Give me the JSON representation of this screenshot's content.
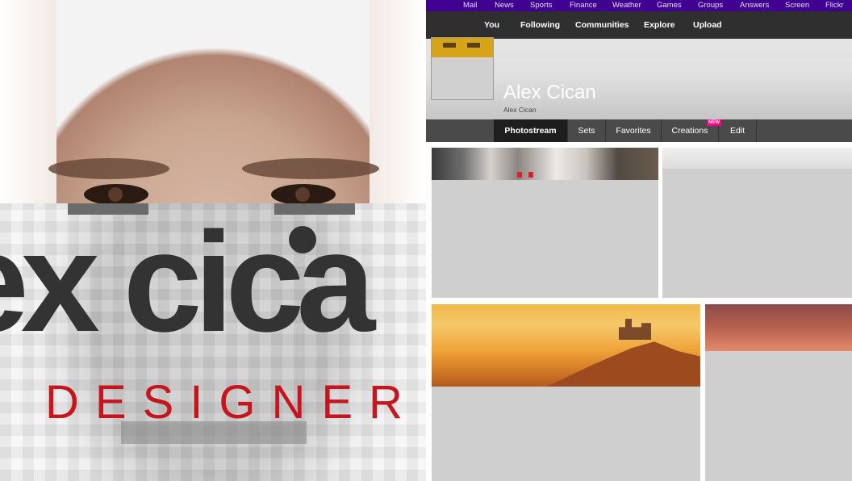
{
  "poster": {
    "name_text": "ex cica",
    "role_text": "DESIGNER",
    "name_color": "#333333",
    "role_color": "#c4161c"
  },
  "yahoo_bar": {
    "background": "#400090",
    "items": [
      "Mail",
      "News",
      "Sports",
      "Finance",
      "Weather",
      "Games",
      "Groups",
      "Answers",
      "Screen",
      "Flickr"
    ]
  },
  "flickr_nav": {
    "items": [
      "You",
      "Following",
      "Communities",
      "Explore",
      "Upload"
    ]
  },
  "profile": {
    "display_name": "Alex Cican",
    "sub_name": "Alex Cican"
  },
  "tabs": {
    "items": [
      "Photostream",
      "Sets",
      "Favorites",
      "Creations",
      "Edit"
    ],
    "active": "Photostream",
    "new_badge": "NEW"
  },
  "photostream": {
    "tiles": [
      "street-photo",
      "light-texture",
      "castle-sunset-landscape",
      "red-sunset-sky"
    ]
  }
}
